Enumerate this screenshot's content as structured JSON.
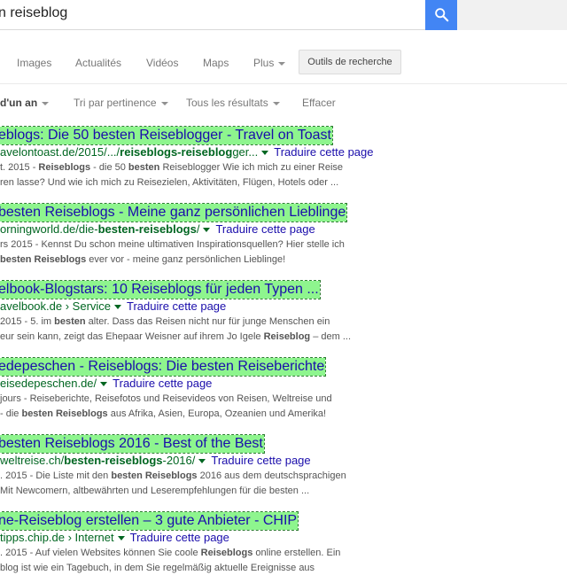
{
  "search": {
    "query": "n reiseblog"
  },
  "tabs": {
    "images": "Images",
    "news": "Actualités",
    "videos": "Vidéos",
    "maps": "Maps",
    "more": "Plus",
    "tools": "Outils de recherche"
  },
  "filters": {
    "time": "d'un an",
    "sort": "Tri par pertinence",
    "all": "Tous les résultats",
    "clear": "Effacer"
  },
  "colors": {
    "search_button": "#4285f4",
    "highlight": "#8ef58e",
    "title": "#1a0dab",
    "url": "#006621",
    "snippet": "#545454"
  },
  "results": [
    {
      "title": "eblogs: Die 50 besten Reiseblogger - Travel on Toast",
      "url_pre": "avelontoast.de/2015/.../",
      "url_bold": "reiseblogs-reiseblog",
      "url_post": "ger...",
      "translate": "Traduire cette page",
      "line1": [
        {
          "t": "t. 2015 - "
        },
        {
          "t": "Reiseblogs",
          "b": true
        },
        {
          "t": " - die 50 "
        },
        {
          "t": "besten",
          "b": true
        },
        {
          "t": " Reiseblogger Wie ich mich zu einer Reise"
        }
      ],
      "line2": [
        {
          "t": "ren lasse? Und wie ich mich zu Reisezielen, Aktivitäten, Flügen, Hotels oder ..."
        }
      ]
    },
    {
      "title": "besten Reiseblogs - Meine ganz persönlichen Lieblinge",
      "url_pre": "orningworld.de/die-",
      "url_bold": "besten-reiseblogs",
      "url_post": "/",
      "translate": "Traduire cette page",
      "line1": [
        {
          "t": "rs 2015 - Kennst Du schon meine ultimativen Inspirationsquellen? Hier stelle ich"
        }
      ],
      "line2": [
        {
          "t": " "
        },
        {
          "t": "besten Reiseblogs",
          "b": true
        },
        {
          "t": " ever vor - meine ganz persönlichen Lieblinge!"
        }
      ]
    },
    {
      "title": "elbook-Blogstars: 10 Reiseblogs für jeden Typen ...",
      "url_pre": "avelbook.de › Service",
      "url_bold": "",
      "url_post": "",
      "translate": "Traduire cette page",
      "line1": [
        {
          "t": "2015 - 5. im "
        },
        {
          "t": "besten",
          "b": true
        },
        {
          "t": " alter. Dass das Reisen nicht nur für junge Menschen ein"
        }
      ],
      "line2": [
        {
          "t": "eur sein kann, zeigt das Ehepaar Weisner auf ihrem Jo Igele "
        },
        {
          "t": "Reiseblog",
          "b": true
        },
        {
          "t": " – dem ..."
        }
      ]
    },
    {
      "title": "edepeschen - Reiseblogs: Die besten Reiseberichte",
      "url_pre": "eisedepeschen.de/",
      "url_bold": "",
      "url_post": "",
      "translate": "Traduire cette page",
      "line1": [
        {
          "t": " jours - Reiseberichte, Reisefotos und Reisevideos von Reisen, Weltreise und"
        }
      ],
      "line2": [
        {
          "t": " - die "
        },
        {
          "t": "besten Reiseblogs",
          "b": true
        },
        {
          "t": " aus Afrika, Asien, Europa, Ozeanien und Amerika!"
        }
      ]
    },
    {
      "title": "besten Reiseblogs 2016 - Best of the Best",
      "url_pre": "weltreise.ch/",
      "url_bold": "besten-reiseblogs",
      "url_post": "-2016/",
      "translate": "Traduire cette page",
      "line1": [
        {
          "t": ". 2015 - Die Liste mit den "
        },
        {
          "t": "besten Reiseblogs",
          "b": true
        },
        {
          "t": " 2016 aus dem deutschsprachigen"
        }
      ],
      "line2": [
        {
          "t": " Mit Newcomern, altbewährten und Leserempfehlungen für die besten ..."
        }
      ]
    },
    {
      "title": "ne-Reiseblog erstellen – 3 gute Anbieter - CHIP",
      "url_pre": "tipps.chip.de › Internet",
      "url_bold": "",
      "url_post": "",
      "translate": "Traduire cette page",
      "line1": [
        {
          "t": ". 2015 - Auf vielen Websites können Sie coole "
        },
        {
          "t": "Reiseblogs",
          "b": true
        },
        {
          "t": " online erstellen. Ein"
        }
      ],
      "line2": [
        {
          "t": "blog ist wie ein Tagebuch, in dem Sie regelmäßig aktuelle Ereignisse aus"
        }
      ]
    }
  ]
}
